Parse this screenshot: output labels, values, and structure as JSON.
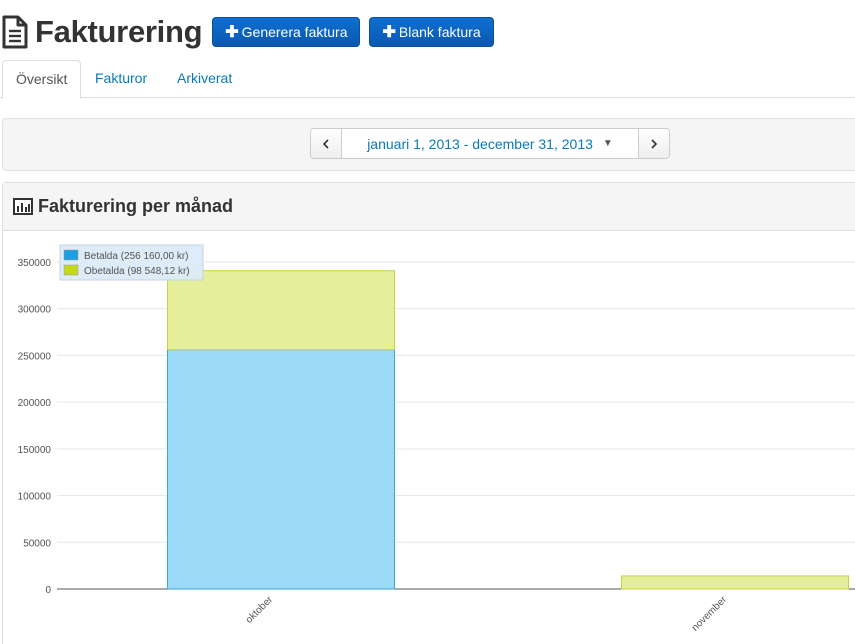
{
  "header": {
    "icon": "document-icon",
    "title": "Fakturering",
    "buttons": [
      {
        "label": "Generera faktura",
        "icon": "plus-icon"
      },
      {
        "label": "Blank faktura",
        "icon": "plus-icon"
      }
    ]
  },
  "tabs": [
    {
      "label": "Översikt",
      "active": true
    },
    {
      "label": "Fakturor",
      "active": false
    },
    {
      "label": "Arkiverat",
      "active": false
    }
  ],
  "date_range": {
    "label": "januari 1, 2013 - december 31, 2013",
    "prev_icon": "chevron-left-icon",
    "next_icon": "chevron-right-icon",
    "caret_icon": "caret-down-icon"
  },
  "panel": {
    "icon": "bar-chart-icon",
    "title": "Fakturering per månad"
  },
  "colors": {
    "brand_blue": "#0b62c4",
    "link": "#0a7ab8",
    "paid_fill": "#9bdaf6",
    "paid_stroke": "#3aa7d6",
    "unpaid_fill": "#e5ee9a",
    "unpaid_stroke": "#c2d640",
    "legend_paid": "#1a9fe0",
    "legend_unpaid": "#c4d91c"
  },
  "chart_data": {
    "type": "bar",
    "stacked": true,
    "categories": [
      "oktober",
      "november"
    ],
    "series": [
      {
        "name": "Betalda (256 160,00 kr)",
        "values": [
          256160,
          0
        ]
      },
      {
        "name": "Obetalda (98 548,12 kr)",
        "values": [
          84548.12,
          14000
        ]
      }
    ],
    "y_ticks": [
      "0",
      "50000",
      "100000",
      "150000",
      "200000",
      "250000",
      "300000",
      "350000"
    ],
    "ylim": [
      0,
      350000
    ],
    "grid": true,
    "legend_position": "top-left"
  }
}
